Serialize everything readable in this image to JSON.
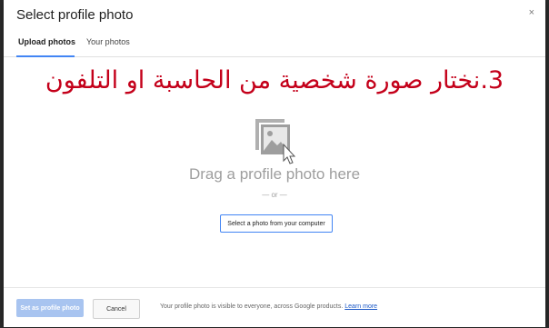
{
  "dialog": {
    "title": "Select profile photo",
    "close": "×"
  },
  "tabs": [
    {
      "label": "Upload photos"
    },
    {
      "label": "Your photos"
    }
  ],
  "annotation": "3.نختار صورة شخصية من الحاسبة او التلفون",
  "upload": {
    "drag_text": "Drag a profile photo here",
    "or_text": "— or —",
    "select_button": "Select a photo from your computer"
  },
  "footer": {
    "set_button": "Set as profile photo",
    "cancel_button": "Cancel",
    "notice": "Your profile photo is visible to everyone, across Google products.",
    "learn_more": "Learn more"
  },
  "colors": {
    "accent": "#4285f4",
    "annotation": "#c4001a",
    "disabled_button": "#a8c4f0"
  },
  "icons": [
    "close-icon",
    "photo-placeholder-icon",
    "cursor-icon"
  ]
}
